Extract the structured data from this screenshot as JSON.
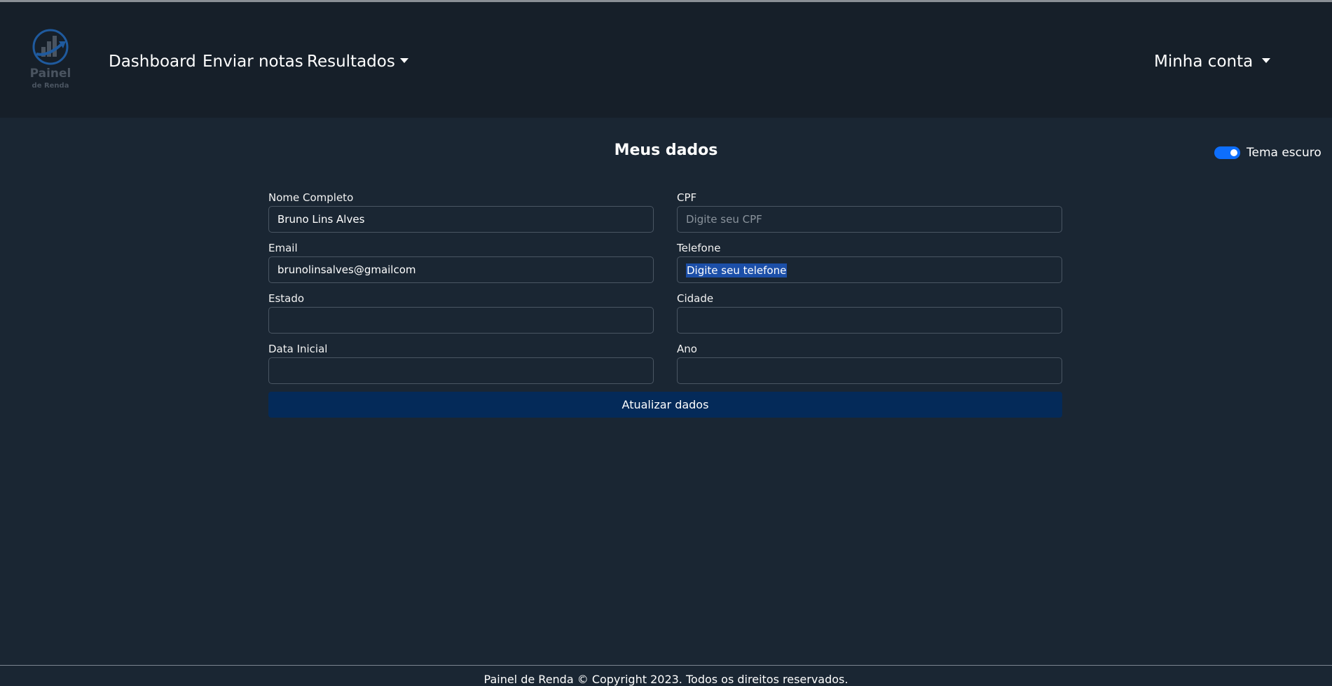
{
  "brand": {
    "logo_line1": "Painel",
    "logo_line2": "de Renda",
    "accent": "#1f5a9e"
  },
  "nav": {
    "items": [
      {
        "label": "Dashboard"
      },
      {
        "label": "Enviar notas"
      },
      {
        "label": "Resultados"
      }
    ],
    "account_label": "Minha conta"
  },
  "page": {
    "title": "Meus dados"
  },
  "theme_toggle": {
    "label": "Tema escuro",
    "checked": true,
    "color": "#0d6efd"
  },
  "form": {
    "fields": {
      "nome": {
        "label": "Nome Completo",
        "value": "Bruno Lins Alves",
        "placeholder": ""
      },
      "cpf": {
        "label": "CPF",
        "value": "",
        "placeholder": "Digite seu CPF"
      },
      "email": {
        "label": "Email",
        "value": "brunolinsalves@gmailcom",
        "placeholder": ""
      },
      "telefone": {
        "label": "Telefone",
        "value": "",
        "placeholder": "Digite seu telefone"
      },
      "estado": {
        "label": "Estado",
        "value": "",
        "placeholder": ""
      },
      "cidade": {
        "label": "Cidade",
        "value": "",
        "placeholder": ""
      },
      "data_inicial": {
        "label": "Data Inicial",
        "value": "",
        "placeholder": ""
      },
      "ano": {
        "label": "Ano",
        "value": "",
        "placeholder": ""
      }
    },
    "submit_label": "Atualizar dados",
    "submit_color": "#042a59"
  },
  "footer": {
    "text": "Painel de Renda © Copyright 2023. Todos os direitos reservados."
  }
}
